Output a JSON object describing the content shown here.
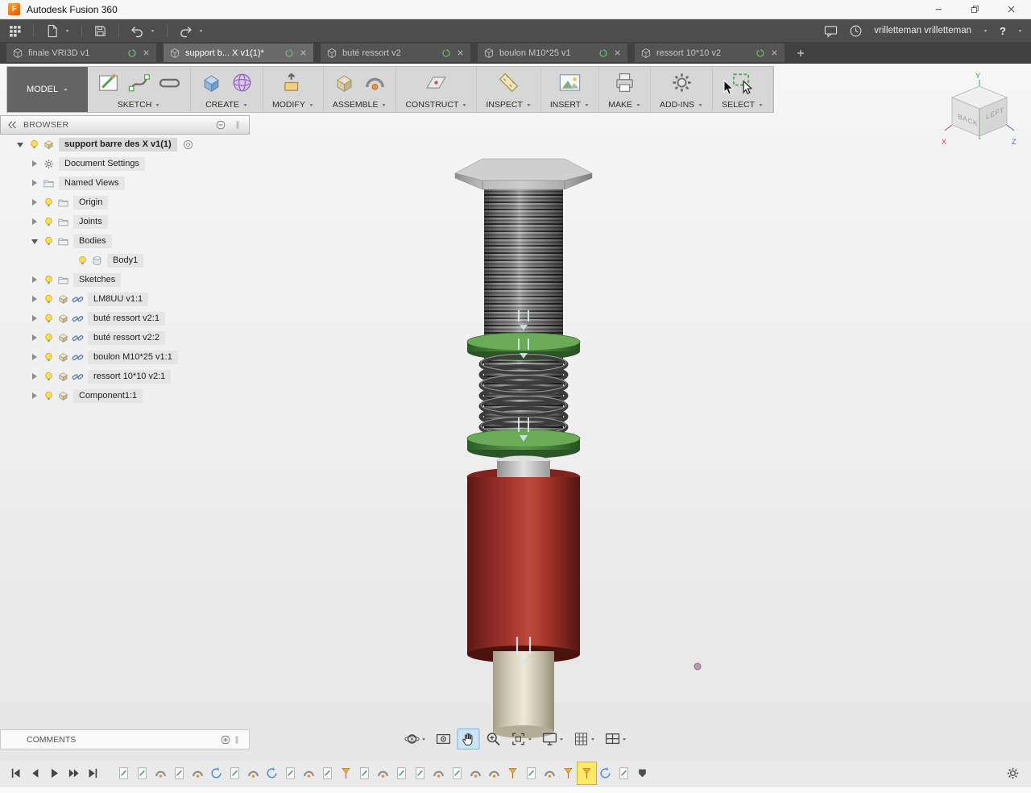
{
  "titlebar": {
    "title": "Autodesk Fusion 360"
  },
  "quick_access": {
    "user": "vrilletteman vrilletteman",
    "help": "?"
  },
  "tabs": [
    {
      "label": "finale VRI3D v1",
      "active": false
    },
    {
      "label": "support b... X v1(1)*",
      "active": true
    },
    {
      "label": "buté ressort v2",
      "active": false
    },
    {
      "label": "boulon M10*25 v1",
      "active": false
    },
    {
      "label": "ressort 10*10 v2",
      "active": false
    }
  ],
  "ribbon": {
    "workspace": "MODEL",
    "groups": [
      {
        "label": "SKETCH",
        "icons": [
          "create-sketch",
          "spline",
          "slot"
        ]
      },
      {
        "label": "CREATE",
        "icons": [
          "extrude",
          "form"
        ]
      },
      {
        "label": "MODIFY",
        "icons": [
          "press-pull"
        ]
      },
      {
        "label": "ASSEMBLE",
        "icons": [
          "new-component",
          "joint"
        ]
      },
      {
        "label": "CONSTRUCT",
        "icons": [
          "construct-plane"
        ]
      },
      {
        "label": "INSPECT",
        "icons": [
          "measure"
        ]
      },
      {
        "label": "INSERT",
        "icons": [
          "insert-image"
        ]
      },
      {
        "label": "MAKE",
        "icons": [
          "make-print"
        ]
      },
      {
        "label": "ADD-INS",
        "icons": [
          "scripts-addins"
        ]
      },
      {
        "label": "SELECT",
        "icons": [
          "select-window"
        ]
      }
    ]
  },
  "viewcube": {
    "face_left": "BACK",
    "face_right": "LEFT",
    "axis_x": "X",
    "axis_y": "Y",
    "axis_z": "Z"
  },
  "browser": {
    "title": "BROWSER",
    "root_label": "support barre des X v1(1)",
    "items": [
      {
        "label": "Document Settings",
        "level": 1,
        "expander": "collapsed",
        "bulb": false,
        "icons": [
          "gear"
        ]
      },
      {
        "label": "Named Views",
        "level": 1,
        "expander": "collapsed",
        "bulb": false,
        "icons": [
          "folder"
        ]
      },
      {
        "label": "Origin",
        "level": 1,
        "expander": "collapsed",
        "bulb": true,
        "icons": [
          "folder"
        ]
      },
      {
        "label": "Joints",
        "level": 1,
        "expander": "collapsed",
        "bulb": true,
        "icons": [
          "folder"
        ]
      },
      {
        "label": "Bodies",
        "level": 1,
        "expander": "expanded",
        "bulb": true,
        "icons": [
          "folder"
        ]
      },
      {
        "label": "Body1",
        "level": 2,
        "expander": "none",
        "bulb": true,
        "icons": [
          "body"
        ]
      },
      {
        "label": "Sketches",
        "level": 1,
        "expander": "collapsed",
        "bulb": true,
        "icons": [
          "folder"
        ]
      },
      {
        "label": "LM8UU v1:1",
        "level": 1,
        "expander": "collapsed",
        "bulb": true,
        "icons": [
          "component",
          "link"
        ]
      },
      {
        "label": "buté ressort v2:1",
        "level": 1,
        "expander": "collapsed",
        "bulb": true,
        "icons": [
          "component",
          "link"
        ]
      },
      {
        "label": "buté ressort v2:2",
        "level": 1,
        "expander": "collapsed",
        "bulb": true,
        "icons": [
          "component",
          "link"
        ]
      },
      {
        "label": "boulon M10*25 v1:1",
        "level": 1,
        "expander": "collapsed",
        "bulb": true,
        "icons": [
          "component",
          "link"
        ]
      },
      {
        "label": "ressort 10*10 v2:1",
        "level": 1,
        "expander": "collapsed",
        "bulb": true,
        "icons": [
          "component",
          "link"
        ]
      },
      {
        "label": "Component1:1",
        "level": 1,
        "expander": "collapsed",
        "bulb": true,
        "icons": [
          "component"
        ]
      }
    ]
  },
  "comments": {
    "label": "COMMENTS"
  },
  "navbar": {
    "buttons": [
      {
        "name": "orbit",
        "caret": true,
        "active": false
      },
      {
        "name": "look-at",
        "caret": false,
        "active": false
      },
      {
        "name": "pan",
        "caret": false,
        "active": true
      },
      {
        "name": "zoom",
        "caret": false,
        "active": false
      },
      {
        "name": "fit",
        "caret": true,
        "active": false
      },
      {
        "name": "display-settings",
        "caret": true,
        "active": false
      },
      {
        "name": "grid-and-snaps",
        "caret": true,
        "active": false
      },
      {
        "name": "viewports",
        "caret": true,
        "active": false
      }
    ]
  },
  "timeline": {
    "controls": [
      "go-to-start",
      "step-back",
      "play",
      "step-forward",
      "go-to-end"
    ],
    "markers": [
      {
        "type": "sketch"
      },
      {
        "type": "sketch"
      },
      {
        "type": "joint"
      },
      {
        "type": "sketch"
      },
      {
        "type": "joint"
      },
      {
        "type": "motion"
      },
      {
        "type": "sketch"
      },
      {
        "type": "joint"
      },
      {
        "type": "motion"
      },
      {
        "type": "sketch"
      },
      {
        "type": "joint"
      },
      {
        "type": "sketch"
      },
      {
        "type": "origin"
      },
      {
        "type": "sketch"
      },
      {
        "type": "joint"
      },
      {
        "type": "sketch"
      },
      {
        "type": "sketch"
      },
      {
        "type": "joint"
      },
      {
        "type": "sketch"
      },
      {
        "type": "joint"
      },
      {
        "type": "joint"
      },
      {
        "type": "origin"
      },
      {
        "type": "sketch"
      },
      {
        "type": "joint"
      },
      {
        "type": "origin"
      },
      {
        "type": "origin",
        "selected": true
      },
      {
        "type": "motion"
      },
      {
        "type": "sketch"
      }
    ]
  },
  "model_parts": {
    "bolt_color": "#b8b8b8",
    "spring_stop_color": "#4e8a43",
    "spring_color": "#3f3f3f",
    "cylinder_color": "#b23c32",
    "rod_color": "#e0dac6"
  }
}
